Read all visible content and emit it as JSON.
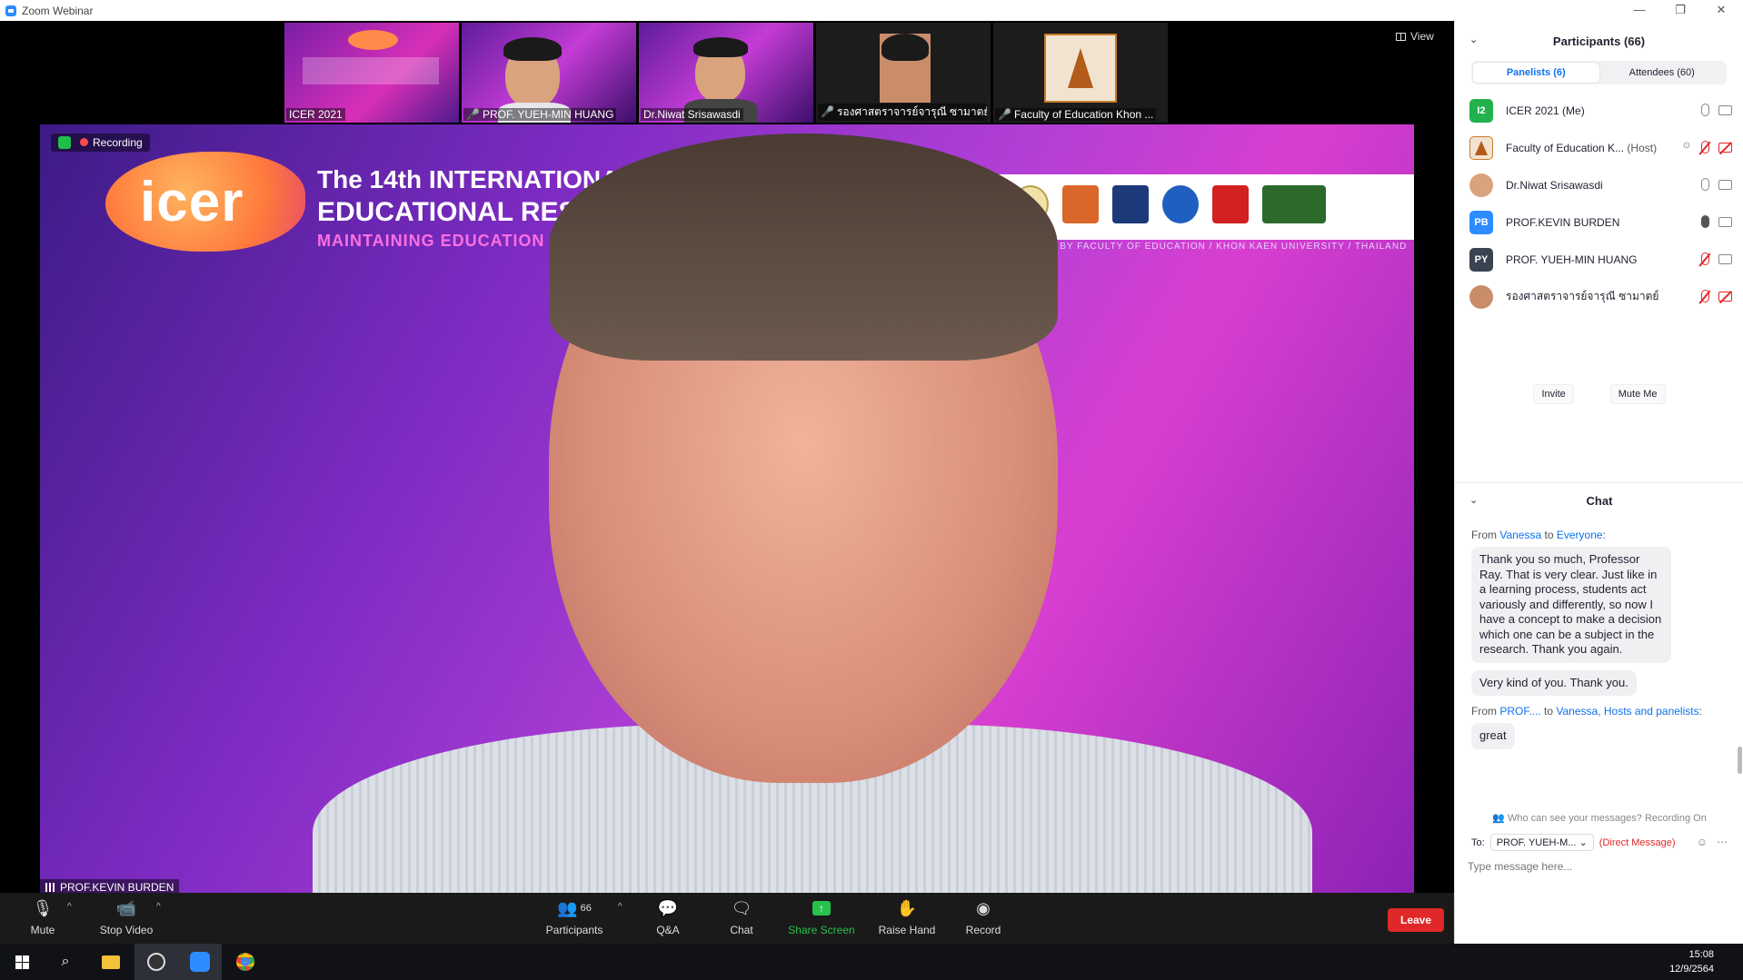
{
  "window": {
    "title": "Zoom Webinar",
    "minimize": "—",
    "maximize": "❐",
    "close": "✕"
  },
  "view": {
    "label": "View"
  },
  "thumbnails": [
    {
      "name": "ICER 2021",
      "muted": false
    },
    {
      "name": "PROF. YUEH-MIN HUANG",
      "muted": true
    },
    {
      "name": "Dr.Niwat Srisawasdi",
      "muted": false
    },
    {
      "name": "รองศาสตราจารย์จารุณี ซามาตย์",
      "muted": true
    },
    {
      "name": "Faculty of Education Khon ...",
      "muted": true
    }
  ],
  "main_video": {
    "recording_label": "Recording",
    "speaker": "PROF.KEVIN BURDEN",
    "poster": {
      "logo": "icer",
      "line1": "The 14th INTERNATIONAL CO",
      "line2": "EDUCATIONAL RES",
      "line3": "MAINTAINING EDUCATION QUA",
      "organizer": "ORGANIZED BY FACULTY OF EDUCATION / KHON KAEN UNIVERSITY / THAILAND"
    }
  },
  "toolbar": {
    "mute": "Mute",
    "stop_video": "Stop Video",
    "participants": "Participants",
    "participants_count": "66",
    "qa": "Q&A",
    "chat": "Chat",
    "share_screen": "Share Screen",
    "raise_hand": "Raise Hand",
    "record": "Record",
    "leave": "Leave"
  },
  "participants_panel": {
    "title": "Participants (66)",
    "tab_panelists": "Panelists (6)",
    "tab_attendees": "Attendees (60)",
    "rows": [
      {
        "initials": "I2",
        "name": "ICER 2021 (Me)",
        "color": "#23b14d"
      },
      {
        "initials": "",
        "name": "Faculty of Education K...",
        "role": "(Host)",
        "color": "#f2e3d0"
      },
      {
        "initials": "",
        "name": "Dr.Niwat Srisawasdi",
        "color": "#d9a37e"
      },
      {
        "initials": "PB",
        "name": "PROF.KEVIN BURDEN",
        "color": "#2d8cff"
      },
      {
        "initials": "PY",
        "name": "PROF. YUEH-MIN HUANG",
        "color": "#3a4350"
      },
      {
        "initials": "",
        "name": "รองศาสตราจารย์จารุณี ซามาตย์",
        "color": "#c98d6b"
      }
    ],
    "invite": "Invite",
    "mute_me": "Mute Me"
  },
  "chat_panel": {
    "title": "Chat",
    "messages": [
      {
        "from": "Vanessa",
        "to": "Everyone",
        "bubbles": [
          "Thank you so much, Professor Ray. That is very clear. Just like in a learning process, students act variously and differently, so now I have a concept to make a decision which one can be a subject in the research. Thank you again.",
          "Very kind of you. Thank you."
        ]
      },
      {
        "from": "PROF....",
        "to": "Vanessa, Hosts and panelists",
        "bubbles": [
          "great"
        ]
      }
    ],
    "from_word": "From",
    "to_word": "to",
    "who_see": "Who can see your messages? Recording On",
    "to_label": "To:",
    "to_value": "PROF. YUEH-M...",
    "direct": "(Direct Message)",
    "placeholder": "Type message here..."
  },
  "taskbar": {
    "time": "15:08",
    "date": "12/9/2564"
  }
}
